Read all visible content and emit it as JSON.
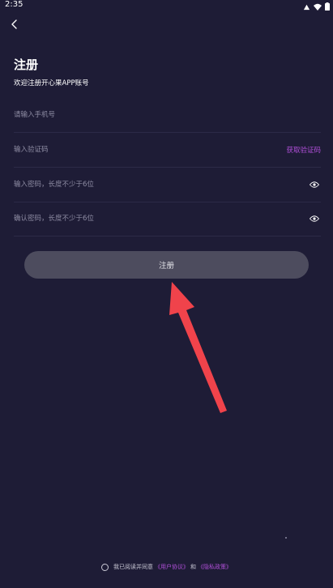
{
  "status_bar": {
    "time": "2:35"
  },
  "header": {
    "back_icon": "chevron-left-icon",
    "title": "注册",
    "subtitle": "欢迎注册开心果APP账号"
  },
  "form": {
    "phone_placeholder": "请输入手机号",
    "code_placeholder": "输入验证码",
    "get_code_label": "获取验证码",
    "password_placeholder": "输入密码，长度不少于6位",
    "confirm_placeholder": "确认密码，长度不少于6位",
    "eye_icon": "eye-icon",
    "submit_label": "注册"
  },
  "agreement": {
    "prefix": "我已阅读并同意",
    "user_agreement": "《用户协议》",
    "and": "和",
    "privacy_policy": "《隐私政策》"
  },
  "colors": {
    "background": "#1e1c36",
    "accent": "#b04fd8",
    "button": "#4d4c5e",
    "arrow": "#f0434b"
  }
}
